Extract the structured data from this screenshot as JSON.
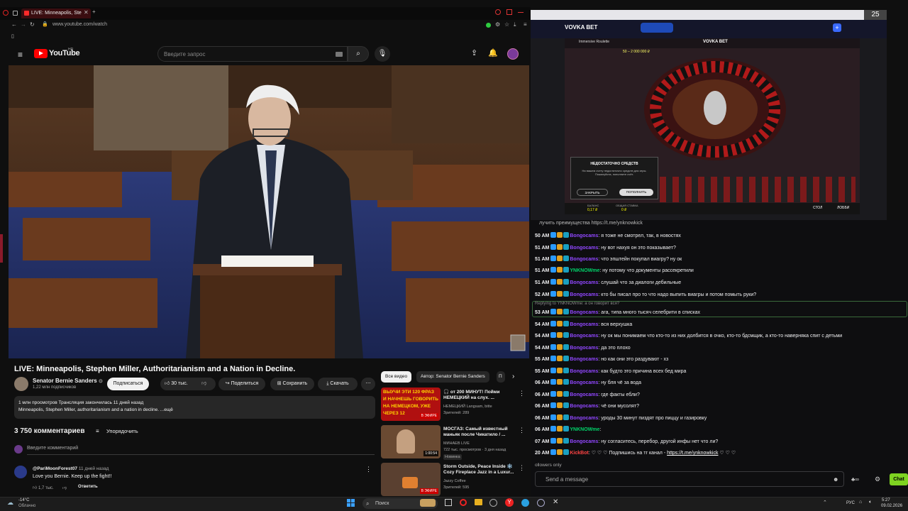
{
  "browser": {
    "tab_title": "LIVE: Minneapolis, Ste",
    "url": "www.youtube.com/watch"
  },
  "youtube": {
    "logo_word": "YouTube",
    "logo_sup": "HR",
    "search_placeholder": "Введите запрос",
    "video": {
      "title": "LIVE: Minneapolis, Stephen Miller, Authoritarianism and a Nation in Decline."
    },
    "channel": {
      "name": "Senator Bernie Sanders",
      "verified": "⊙",
      "subs": "1,22 млн подписчиков",
      "subscribe_label": "Подписаться"
    },
    "actions": {
      "likes": "30 тыс.",
      "share": "Поделиться",
      "save": "Сохранить",
      "download": "Скачать"
    },
    "description": {
      "line1": "1 млн просмотров  Трансляция закончилась 11 дней назад",
      "line2": "Minneapolis, Stephen Miller, authoritarianism and a nation in decline. ...ещё"
    },
    "comments": {
      "count": "3 750 комментариев",
      "sort_label": "Упорядочить",
      "input_placeholder": "Введите комментарий",
      "first": {
        "author": "@PariMoonForest07",
        "time": "11 дней назад",
        "text": "Love you Bernie. Keep up the fight!!",
        "likes": "1,7 тыс.",
        "reply": "Ответить"
      }
    },
    "chips": [
      "Все видео",
      "Автор: Senator Bernie Sanders",
      "П"
    ],
    "recommended": [
      {
        "title": "🎧 от 200 МИНУТ! Пойми НЕМЕЦКИЙ на слух. ...",
        "channel": "НЕМЕЦКИЙ Langsam, bitte",
        "meta": "Зрителей: 289",
        "thumb_text": "ВЫУЧИ ЭТИ 120 ФРАЗ И НАЧНЕШЬ ГОВОРИТЬ НА НЕМЕЦКОМ, УЖЕ ЧЕРЕЗ 12",
        "badge": "В ЭФИРЕ"
      },
      {
        "title": "МОСГАЗ: Самый известный маньяк после Чикатило / ...",
        "channel": "МИНАЕВ LIVE",
        "meta": "722 тыс. просмотров · 3 дня назад",
        "tag": "Новинка",
        "duration": "1:00:54"
      },
      {
        "title": "Storm Outside, Peace Inside ❄️ Cozy Fireplace Jazz in a Luxur...",
        "channel": "Jazzy Coffee",
        "meta": "Зрителей: 595",
        "badge": "В ЭФИРЕ"
      }
    ]
  },
  "stream": {
    "brand": "VOVKA BET",
    "game_title": "Immersive Roulette",
    "limits": "50 – 2 000 000 ₽",
    "dialog_title": "НЕДОСТАТОЧНО СРЕДСТВ",
    "dialog_text": "На вашем счету недостаточно средств для игры. Пожалуйста, пополните счёт.",
    "dialog_close": "ЗАКРЫТЬ",
    "dialog_topup": "ПОПОЛНИТЬ",
    "corner_number": "25",
    "balance_label": "БАЛАНС",
    "bet_label": "ОБЩАЯ СТАВКА",
    "balance": "0,17 ₽",
    "bet": "0 ₽",
    "stol": "СТОЛ",
    "lobby": "ЛОББИ"
  },
  "chat": {
    "header_text": "лучить преимущества https://t.me/ynknowkick",
    "messages": [
      {
        "time": "50 AM",
        "user": "Bongocams",
        "text": ": я тоже не смотрел, так, в новостях"
      },
      {
        "time": "51 AM",
        "user": "Bongocams",
        "text": ": ну вот нахуя он это показывает?"
      },
      {
        "time": "51 AM",
        "user": "Bongocams",
        "text": ": что эпштейн покупал виагру? ну ок"
      },
      {
        "time": "51 AM",
        "user": "YNKNOWme",
        "text": ": ну потому что документы рассекретили"
      },
      {
        "time": "51 AM",
        "user": "Bongocams",
        "text": ": слушай что за диалоги дебильные"
      },
      {
        "time": "52 AM",
        "user": "Bongocams",
        "text": ": кто бы писал про то что надо выпить виагры и потом помыть руки?"
      },
      {
        "time": "53 AM",
        "user": "Bongocams",
        "text": ": ага, типа много тысяч селебрити в списках",
        "reply": "Replying to YNKNOWme: а он говорит вся?"
      },
      {
        "time": "54 AM",
        "user": "Bongocams",
        "text": ": вся верхушка"
      },
      {
        "time": "54 AM",
        "user": "Bongocams",
        "text": ": ну ок мы понимаем что кто-то из них долбится в очко, кто-то бдсмщик, а кто-то наверняка спит с детьми"
      },
      {
        "time": "54 AM",
        "user": "Bongocams",
        "text": ": да это плохо"
      },
      {
        "time": "55 AM",
        "user": "Bongocams",
        "text": ": но как они это раздувают - хз"
      },
      {
        "time": "55 AM",
        "user": "Bongocams",
        "text": ": как будто это причина всех бед мира"
      },
      {
        "time": "06 AM",
        "user": "Bongocams",
        "text": ": ну бля чё за вода"
      },
      {
        "time": "06 AM",
        "user": "Bongocams",
        "text": ": где факты ебли?"
      },
      {
        "time": "06 AM",
        "user": "Bongocams",
        "text": ": чё они мусолят?"
      },
      {
        "time": "06 AM",
        "user": "Bongocams",
        "text": ": уроды 30 минут пиздят про пиццу и газировку"
      },
      {
        "time": "06 AM",
        "user": "YNKNOWme",
        "text": ":"
      },
      {
        "time": "07 AM",
        "user": "Bongocams",
        "text": ": ну согласитесь, перебор, другой инфы нет что ли?"
      },
      {
        "time": "20 AM",
        "user": "KickBot",
        "text": ": ♡ ♡ ♡ Подпишись на тг канал - ",
        "link": "https://t.me/ynknowkick",
        "tail": " ♡ ♡ ♡"
      }
    ],
    "followers_only": "ollowers only",
    "input_placeholder": "Send a message",
    "send_label": "Chat"
  },
  "taskbar": {
    "weather_temp": "-14°C",
    "weather_text": "Облачно",
    "search_label": "Поиск",
    "lang": "РУС",
    "time": "5:27",
    "date": "09.02.2026"
  }
}
